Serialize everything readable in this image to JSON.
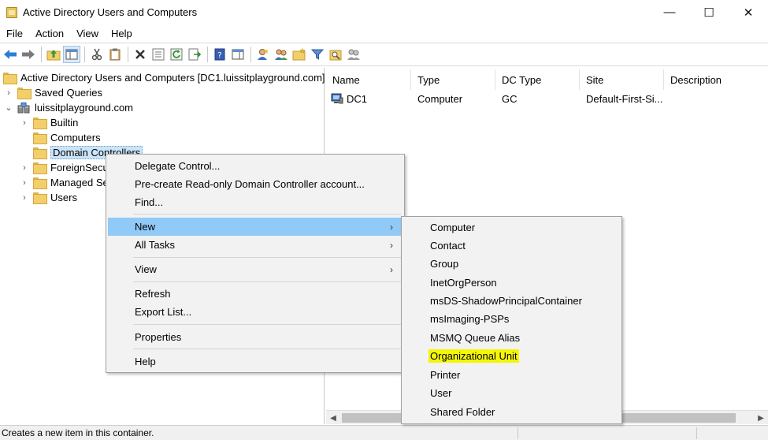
{
  "window": {
    "title": "Active Directory Users and Computers",
    "minimize": "—",
    "maximize": "☐",
    "close": "✕"
  },
  "menubar": [
    "File",
    "Action",
    "View",
    "Help"
  ],
  "tree": {
    "root": "Active Directory Users and Computers [DC1.luissitplayground.com]",
    "saved_queries": "Saved Queries",
    "domain": "luissitplayground.com",
    "children": [
      "Builtin",
      "Computers",
      "Domain Controllers",
      "ForeignSecu",
      "Managed Se",
      "Users"
    ]
  },
  "list": {
    "columns": [
      "Name",
      "Type",
      "DC Type",
      "Site",
      "Description"
    ],
    "rows": [
      {
        "name": "DC1",
        "type": "Computer",
        "dc_type": "GC",
        "site": "Default-First-Si...",
        "description": ""
      }
    ]
  },
  "context_menu": {
    "delegate": "Delegate Control...",
    "precreate": "Pre-create Read-only Domain Controller account...",
    "find": "Find...",
    "new": "New",
    "all_tasks": "All Tasks",
    "view": "View",
    "refresh": "Refresh",
    "export": "Export List...",
    "properties": "Properties",
    "help": "Help",
    "submenu_arrow": "›"
  },
  "submenu": [
    "Computer",
    "Contact",
    "Group",
    "InetOrgPerson",
    "msDS-ShadowPrincipalContainer",
    "msImaging-PSPs",
    "MSMQ Queue Alias",
    "Organizational Unit",
    "Printer",
    "User",
    "Shared Folder"
  ],
  "status": "Creates a new item in this container.",
  "colors": {
    "menu_hover": "#91c9f7",
    "highlight": "#f5f50a",
    "selected": "#cce4f7"
  }
}
